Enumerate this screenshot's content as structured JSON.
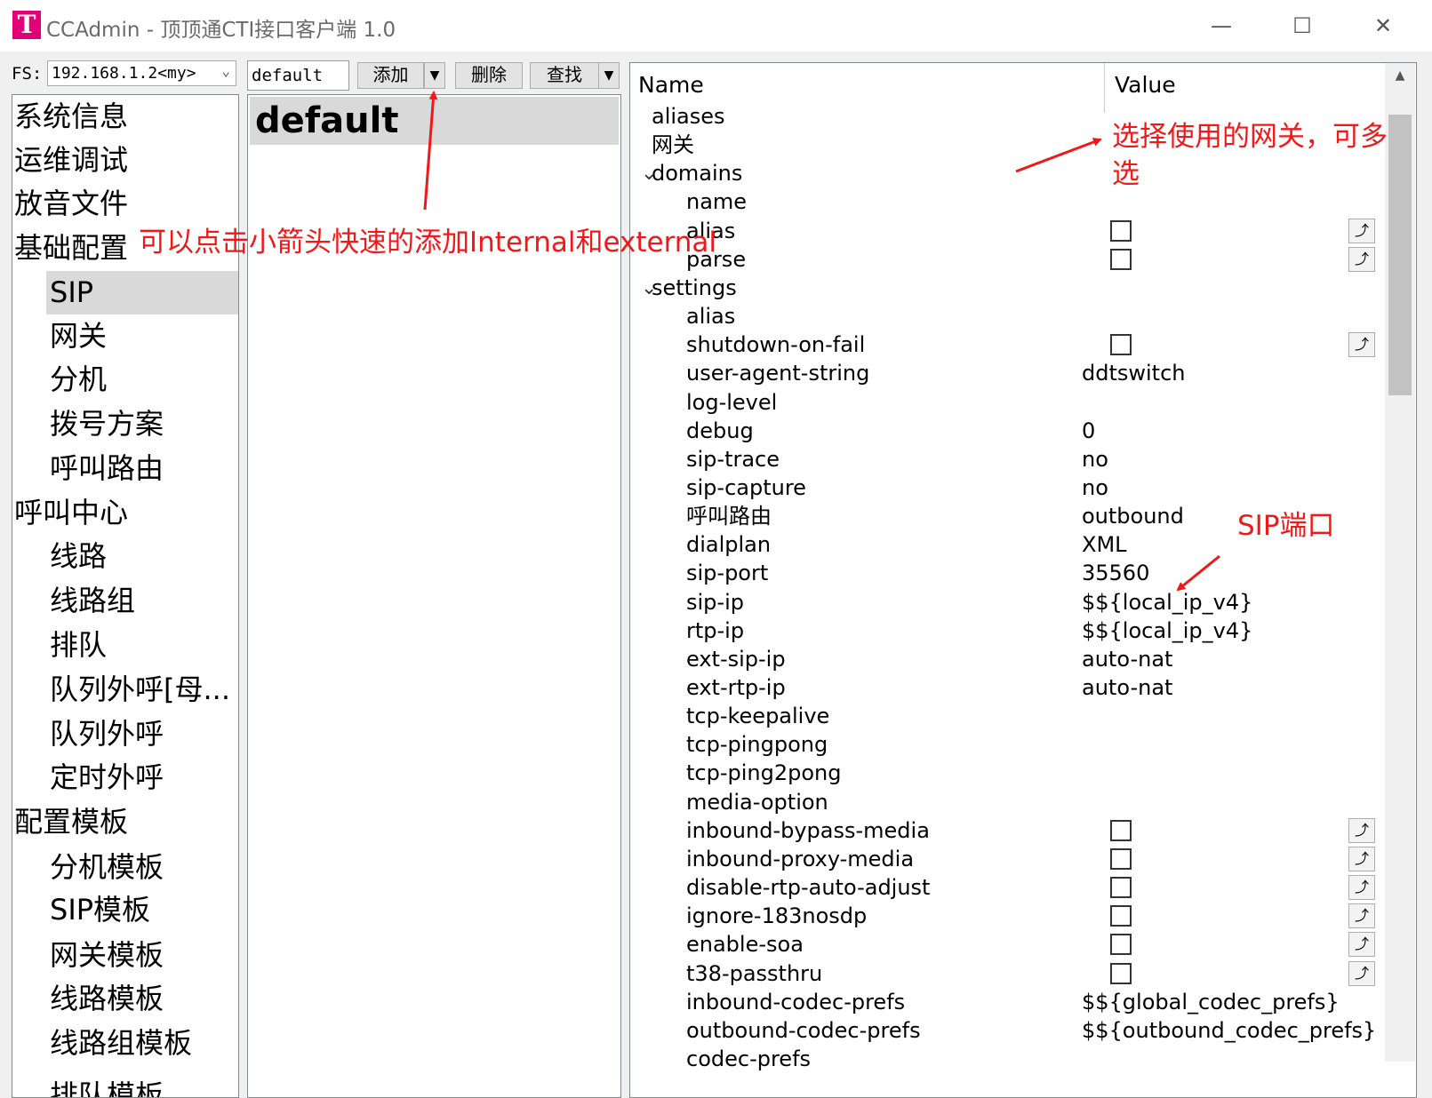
{
  "window": {
    "title": "CCAdmin - 顶顶通CTI接口客户端 1.0",
    "logo_letter": "T",
    "minimize": "—",
    "maximize": "☐",
    "close": "✕"
  },
  "toolbar": {
    "fs_label": "FS:",
    "fs_value": "192.168.1.2<my>",
    "name_value": "default",
    "add_label": "添加",
    "delete_label": "删除",
    "find_label": "查找",
    "dropdown_glyph": "▼"
  },
  "nav": {
    "items": [
      {
        "label": "系统信息"
      },
      {
        "label": "运维调试"
      },
      {
        "label": "放音文件"
      },
      {
        "label": "基础配置"
      },
      {
        "label": "SIP"
      },
      {
        "label": "网关"
      },
      {
        "label": "分机"
      },
      {
        "label": "拨号方案"
      },
      {
        "label": "呼叫路由"
      },
      {
        "label": "呼叫中心"
      },
      {
        "label": "线路"
      },
      {
        "label": "线路组"
      },
      {
        "label": "排队"
      },
      {
        "label": "队列外呼[母..."
      },
      {
        "label": "队列外呼"
      },
      {
        "label": "定时外呼"
      },
      {
        "label": "配置模板"
      },
      {
        "label": "分机模板"
      },
      {
        "label": "SIP模板"
      },
      {
        "label": "网关模板"
      },
      {
        "label": "线路模板"
      },
      {
        "label": "线路组模板"
      },
      {
        "label": "排队模板"
      }
    ]
  },
  "profile_list": {
    "selected": "default"
  },
  "props": {
    "col_name": "Name",
    "col_value": "Value",
    "button_glyph": "⤴",
    "rows": [
      {
        "name": "aliases",
        "value": ""
      },
      {
        "name": "网关",
        "value": ""
      },
      {
        "name": "domains",
        "value": "",
        "toggle": "⌄"
      },
      {
        "name": "name",
        "value": ""
      },
      {
        "name": "alias",
        "value": ""
      },
      {
        "name": "parse",
        "value": ""
      },
      {
        "name": "settings",
        "value": "",
        "toggle": "⌄"
      },
      {
        "name": "alias",
        "value": ""
      },
      {
        "name": "shutdown-on-fail",
        "value": ""
      },
      {
        "name": "user-agent-string",
        "value": "ddtswitch"
      },
      {
        "name": "log-level",
        "value": ""
      },
      {
        "name": "debug",
        "value": "0"
      },
      {
        "name": "sip-trace",
        "value": "no"
      },
      {
        "name": "sip-capture",
        "value": "no"
      },
      {
        "name": "呼叫路由",
        "value": "outbound"
      },
      {
        "name": "dialplan",
        "value": "XML"
      },
      {
        "name": "sip-port",
        "value": "35560"
      },
      {
        "name": "sip-ip",
        "value": "$${local_ip_v4}"
      },
      {
        "name": "rtp-ip",
        "value": "$${local_ip_v4}"
      },
      {
        "name": "ext-sip-ip",
        "value": "auto-nat"
      },
      {
        "name": "ext-rtp-ip",
        "value": "auto-nat"
      },
      {
        "name": "tcp-keepalive",
        "value": ""
      },
      {
        "name": "tcp-pingpong",
        "value": ""
      },
      {
        "name": "tcp-ping2pong",
        "value": ""
      },
      {
        "name": "media-option",
        "value": ""
      },
      {
        "name": "inbound-bypass-media",
        "value": ""
      },
      {
        "name": "inbound-proxy-media",
        "value": ""
      },
      {
        "name": "disable-rtp-auto-adjust",
        "value": ""
      },
      {
        "name": "ignore-183nosdp",
        "value": ""
      },
      {
        "name": "enable-soa",
        "value": ""
      },
      {
        "name": "t38-passthru",
        "value": ""
      },
      {
        "name": "inbound-codec-prefs",
        "value": "$${global_codec_prefs}"
      },
      {
        "name": "outbound-codec-prefs",
        "value": "$${outbound_codec_prefs}"
      },
      {
        "name": "codec-prefs",
        "value": ""
      }
    ]
  },
  "annotations": {
    "add_hint": "可以点击小箭头快速的添加Internal和external",
    "gateway_hint": "选择使用的网关，可多选",
    "port_hint": "SIP端口"
  },
  "colors": {
    "annotation": "#f01818",
    "logo": "#e2007a",
    "selection": "#d9d9d9"
  }
}
